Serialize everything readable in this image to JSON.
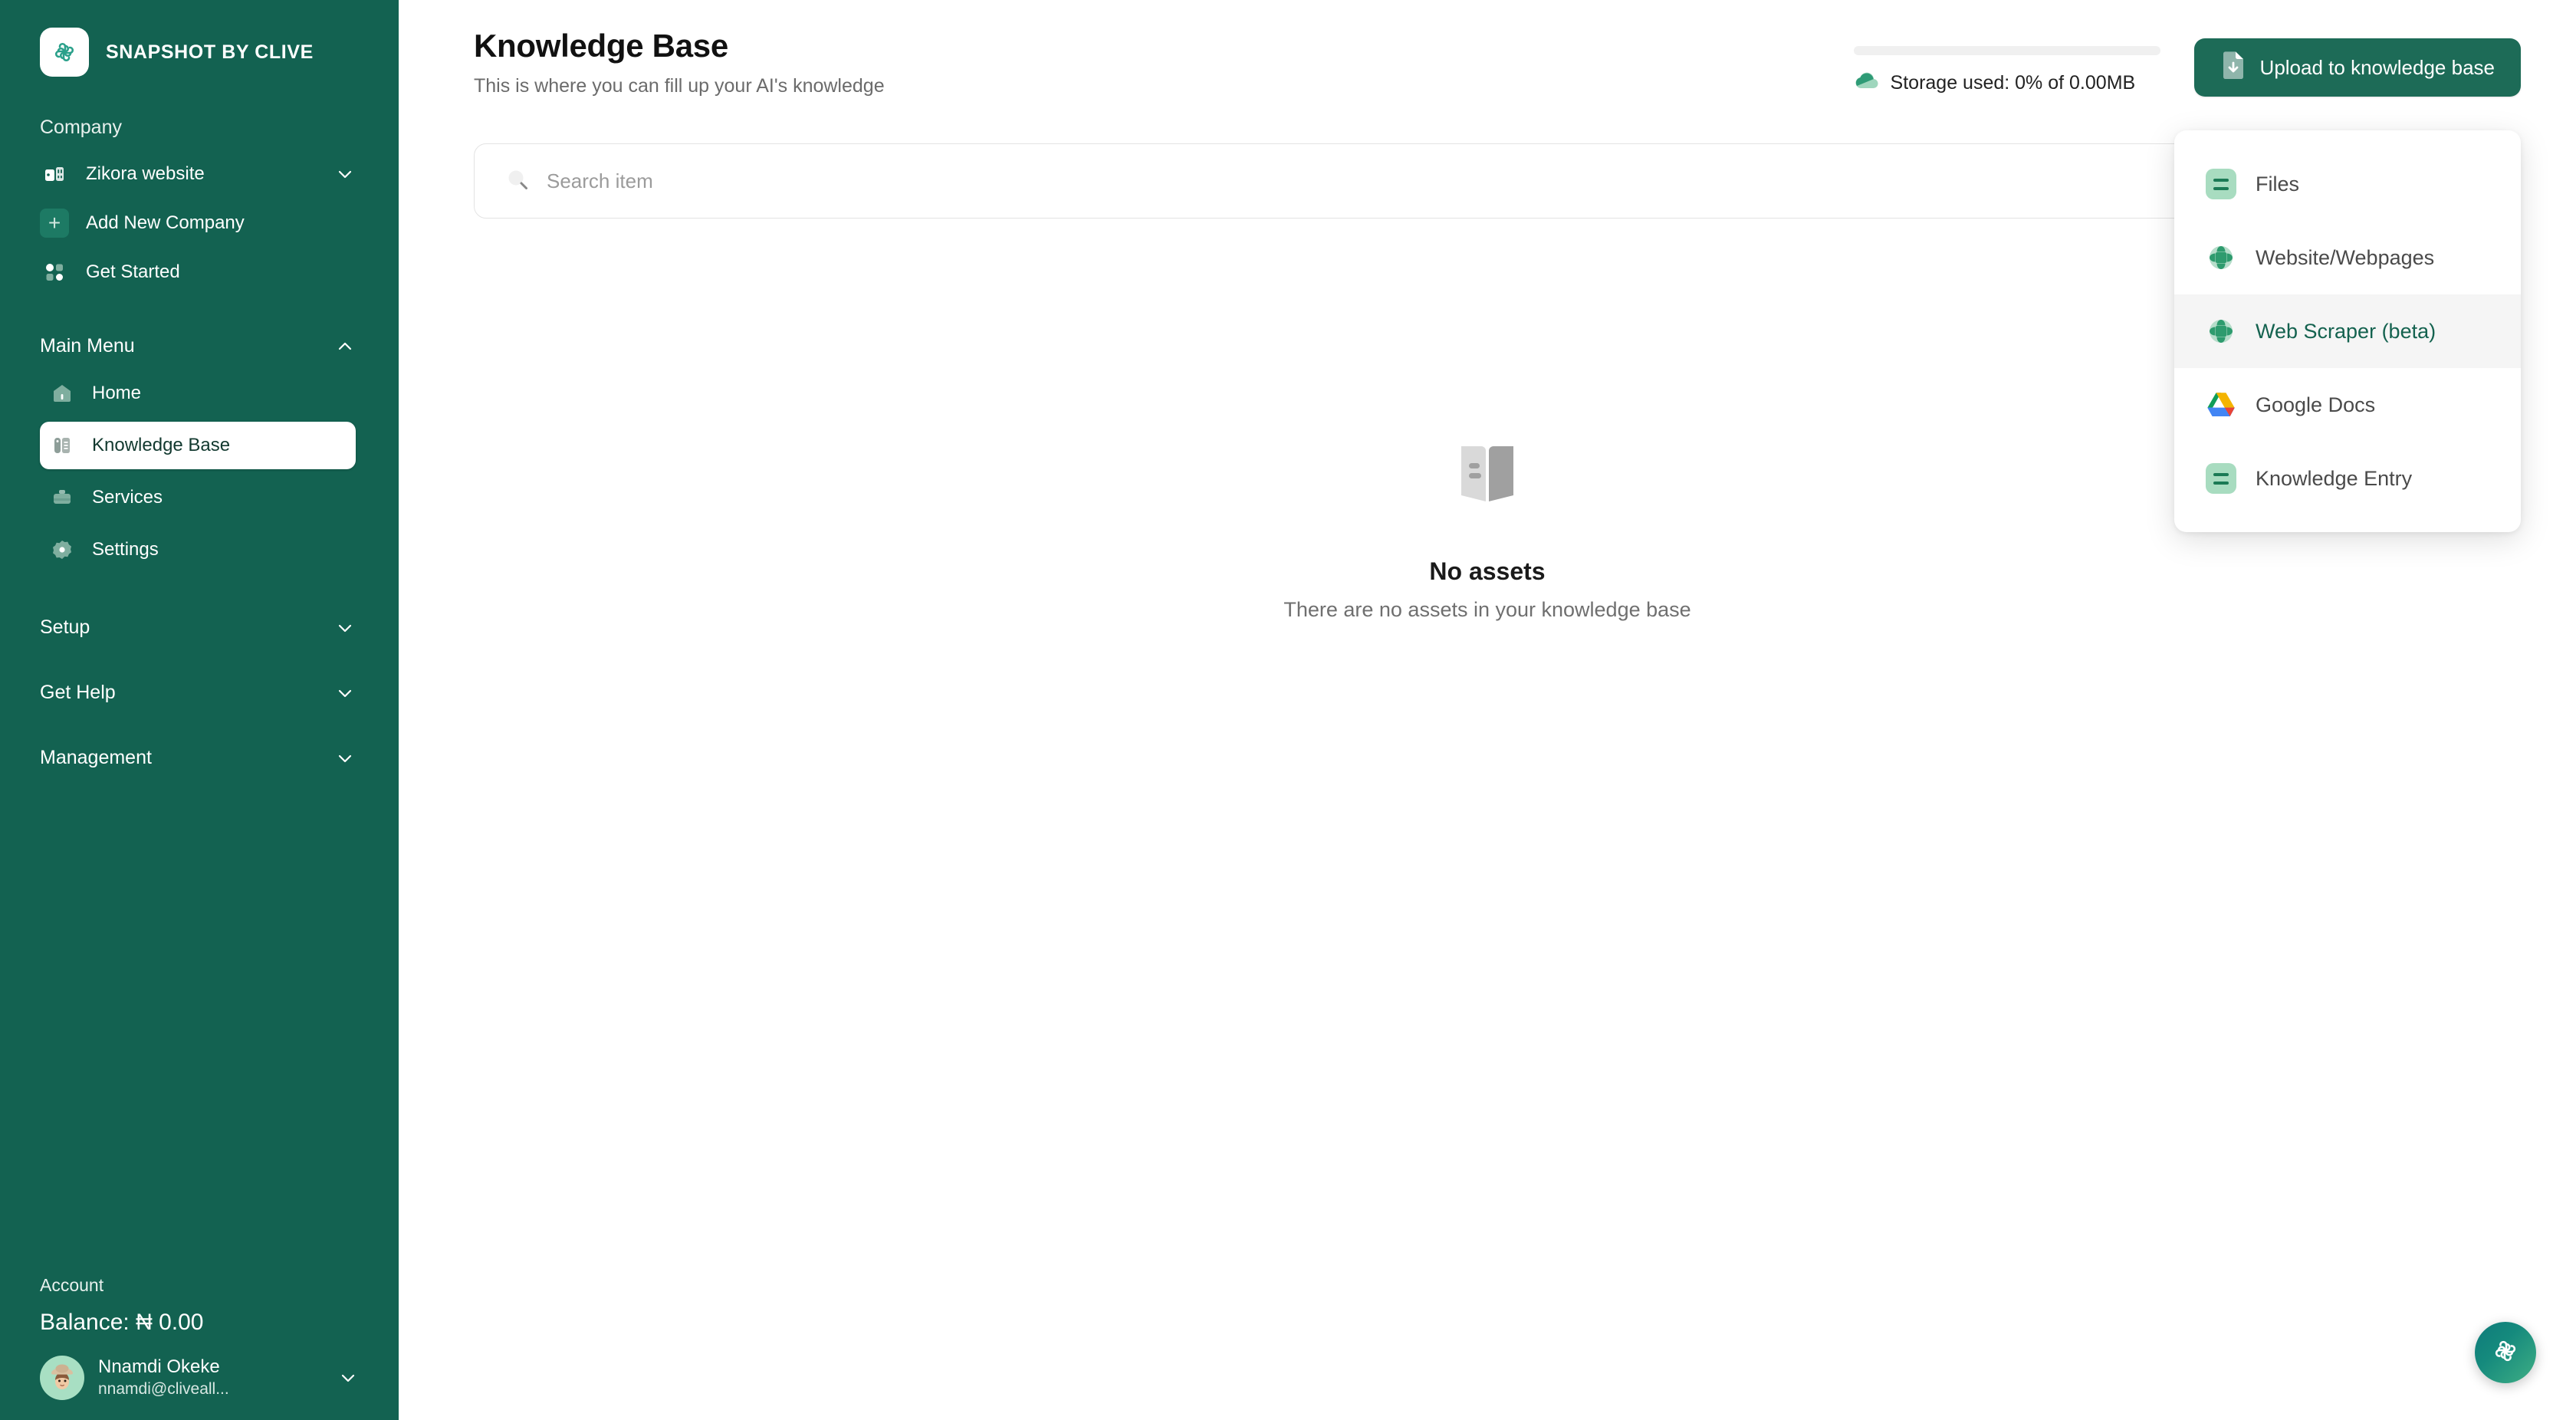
{
  "brand": {
    "name": "SNAPSHOT BY CLIVE",
    "logo_icon": "snapshot-logo-icon"
  },
  "sidebar": {
    "company_label": "Company",
    "company_items": [
      {
        "label": "Zikora website",
        "icon": "company-building-icon",
        "trailing_icon": "chevron-down-icon"
      },
      {
        "label": "Add New Company",
        "icon": "plus-icon"
      },
      {
        "label": "Get Started",
        "icon": "dots-grid-icon"
      }
    ],
    "main_menu": {
      "label": "Main Menu",
      "trailing_icon": "chevron-up-icon",
      "items": [
        {
          "label": "Home",
          "icon": "home-icon",
          "active": false
        },
        {
          "label": "Knowledge Base",
          "icon": "knowledge-base-icon",
          "active": true
        },
        {
          "label": "Services",
          "icon": "services-icon",
          "active": false
        },
        {
          "label": "Settings",
          "icon": "settings-icon",
          "active": false
        }
      ]
    },
    "sections": [
      {
        "label": "Setup",
        "trailing_icon": "chevron-down-icon"
      },
      {
        "label": "Get Help",
        "trailing_icon": "chevron-down-icon"
      },
      {
        "label": "Management",
        "trailing_icon": "chevron-down-icon"
      }
    ],
    "account": {
      "label": "Account",
      "balance": "Balance: ₦ 0.00",
      "user_name": "Nnamdi Okeke",
      "user_email": "nnamdi@cliveall...",
      "avatar_icon": "user-avatar",
      "trailing_icon": "chevron-down-icon"
    }
  },
  "header": {
    "title": "Knowledge Base",
    "subtitle": "This is where you can fill up your AI's knowledge",
    "storage_text": "Storage used: 0% of 0.00MB",
    "storage_percent": 0,
    "storage_icon": "cloud-storage-icon",
    "upload_button": "Upload to knowledge base",
    "upload_icon": "file-download-icon"
  },
  "search": {
    "placeholder": "Search item",
    "value": "",
    "icon": "search-icon"
  },
  "dropdown": {
    "items": [
      {
        "label": "Files",
        "icon": "file-tile-icon",
        "highlighted": false
      },
      {
        "label": "Website/Webpages",
        "icon": "globe-icon",
        "highlighted": false
      },
      {
        "label": "Web Scraper (beta)",
        "icon": "globe-icon",
        "highlighted": true
      },
      {
        "label": "Google Docs",
        "icon": "google-drive-icon",
        "highlighted": false
      },
      {
        "label": "Knowledge Entry",
        "icon": "file-tile-icon",
        "highlighted": false
      }
    ]
  },
  "empty_state": {
    "icon": "open-book-icon",
    "title": "No assets",
    "subtitle": "There are no assets in your knowledge base"
  },
  "fab": {
    "icon": "snapshot-logo-icon"
  },
  "colors": {
    "sidebar_bg": "#136251",
    "accent_green": "#1d6b57",
    "highlight_text": "#14624f",
    "tile_green": "#a8dcc0",
    "page_bg": "#ffffff"
  }
}
